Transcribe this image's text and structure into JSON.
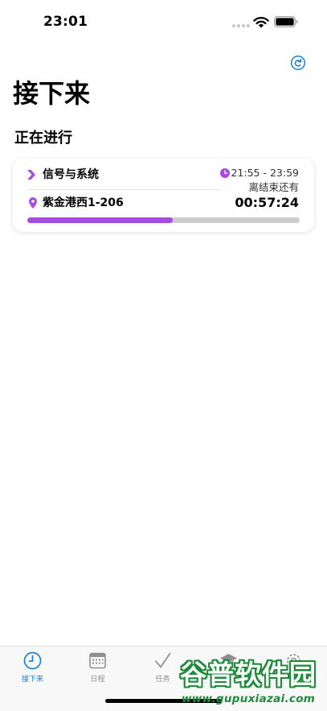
{
  "status_bar": {
    "time": "23:01"
  },
  "header": {
    "title": "接下来",
    "refresh_icon": "refresh-icon"
  },
  "section": {
    "title": "正在进行"
  },
  "current_event": {
    "course": "信号与系统",
    "location": "紫金港西1-206",
    "time_range": "21:55 - 23:59",
    "remaining_label": "离结束还有",
    "countdown": "00:57:24",
    "progress": 0.535,
    "accent_color": "#a64ae2"
  },
  "tabs": [
    {
      "label": "接下来",
      "icon": "clock-icon",
      "active": true
    },
    {
      "label": "日程",
      "icon": "calendar-icon",
      "active": false
    },
    {
      "label": "任务",
      "icon": "checkmark-icon",
      "active": false
    },
    {
      "label": "",
      "icon": "graduation-cap-icon",
      "active": false
    },
    {
      "label": "",
      "icon": "gear-icon",
      "active": false
    }
  ],
  "colors": {
    "active_tab": "#1a7fd4",
    "inactive_tab": "#8e8e93",
    "track": "#cdcdd0"
  },
  "watermark": {
    "main": "谷普软件园",
    "url": "www.gupuxiazai.com"
  }
}
